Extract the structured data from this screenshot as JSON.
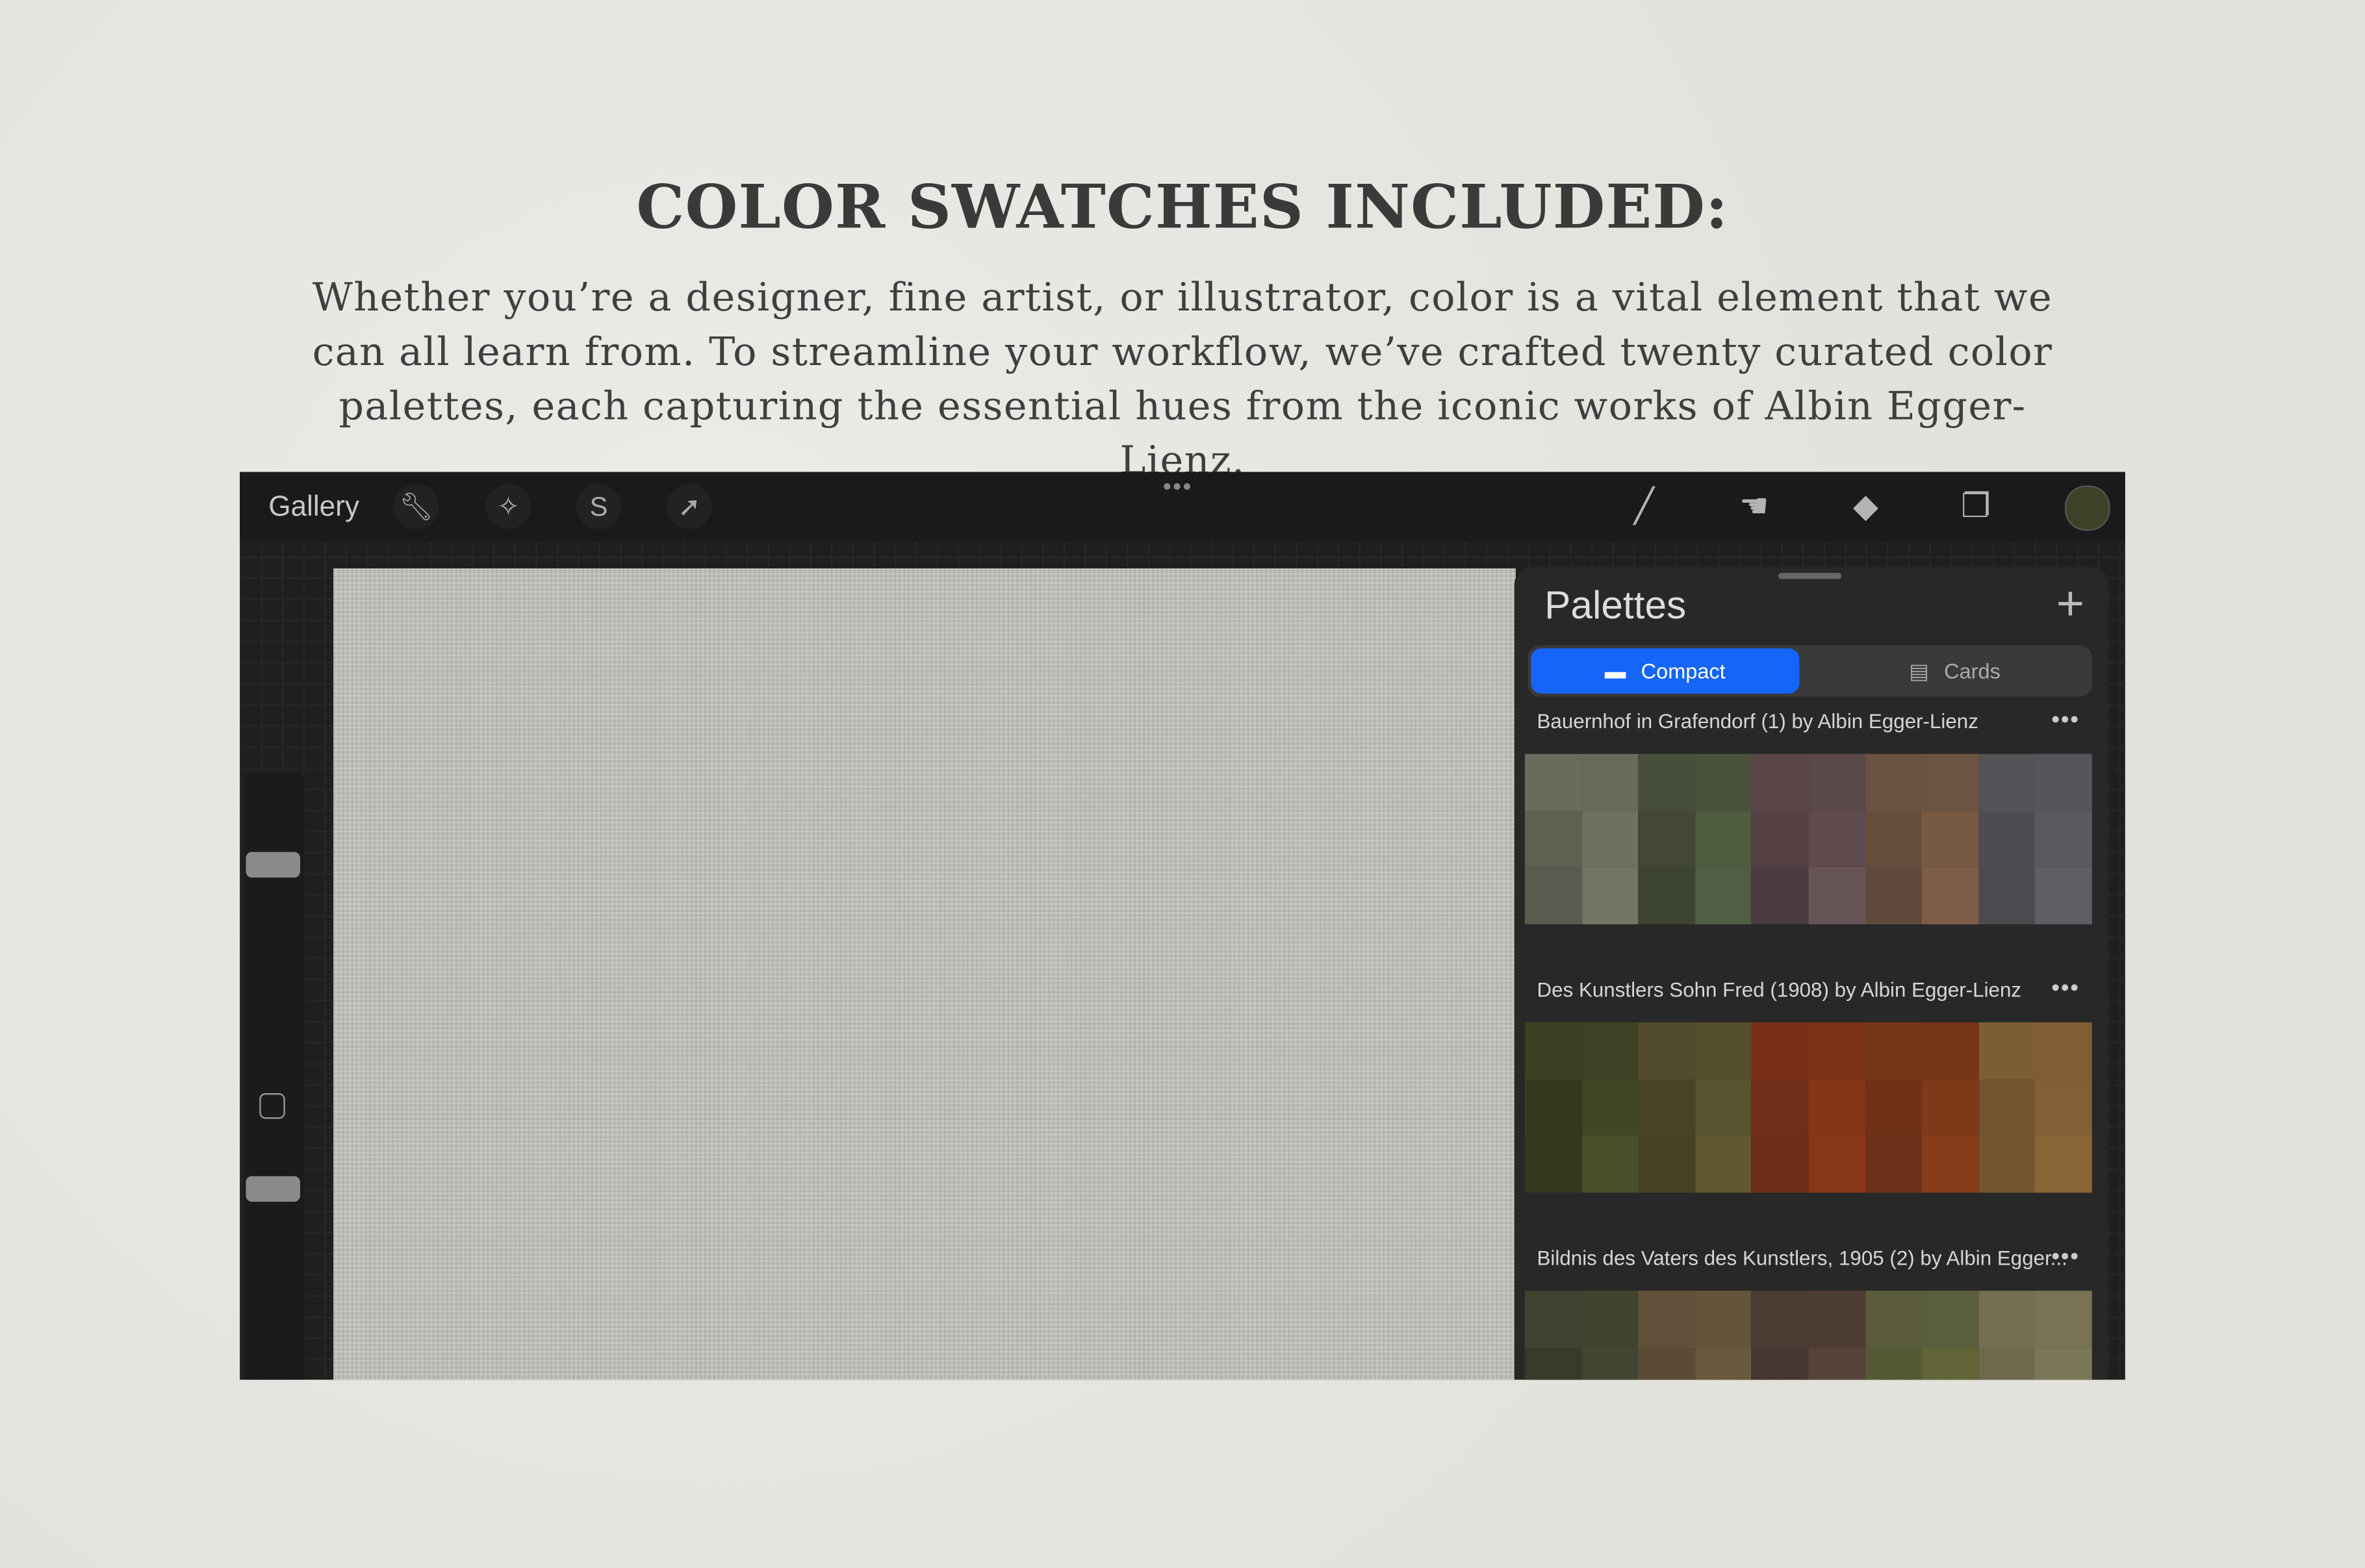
{
  "heading": "COLOR SWATCHES INCLUDED:",
  "description": "Whether you’re a designer, fine artist, or illustrator, color is a vital element that we can all learn from. To streamline your workflow, we’ve crafted twenty curated color palettes, each capturing the essential hues from the iconic works of Albin Egger-Lienz.",
  "toolbar": {
    "gallery": "Gallery",
    "left_icons": [
      "wrench-icon",
      "magic-wand-icon",
      "selection-icon",
      "transform-arrow-icon"
    ],
    "more": "•••",
    "right_icons": [
      "brush-icon",
      "smudge-icon",
      "eraser-icon",
      "layers-icon"
    ],
    "current_color": "#3e4028"
  },
  "panel": {
    "title": "Palettes",
    "add": "+",
    "tabs": [
      {
        "label": "Compact",
        "active": true
      },
      {
        "label": "Cards",
        "active": false
      }
    ],
    "palettes": [
      {
        "name": "Bauernhof in Grafendorf (1) by Albin Egger-Lienz",
        "more": "•••",
        "colors": [
          "#6b6b5d",
          "#6a6a5c",
          "#474f3a",
          "#4a523c",
          "#5a4648",
          "#5c494a",
          "#6b5341",
          "#6c5442",
          "#545358",
          "#56555b",
          "#606052",
          "#6f705f",
          "#434835",
          "#505c40",
          "#544043",
          "#5f4b4e",
          "#674d3e",
          "#785a43",
          "#4e4c52",
          "#5b5a60",
          "#5a5a4e",
          "#717562",
          "#3e4432",
          "#525e44",
          "#4a3c3e",
          "#665456",
          "#604a3d",
          "#7d5d48",
          "#4b4a4e",
          "#5f5e65"
        ]
      },
      {
        "name": "Des Kunstlers Sohn Fred (1908) by Albin Egger-Lienz",
        "more": "•••",
        "colors": [
          "#3d4123",
          "#3f4224",
          "#514a2b",
          "#554e2c",
          "#7a3018",
          "#7a3118",
          "#773518",
          "#753318",
          "#7d5d33",
          "#7f5e34",
          "#363920",
          "#434626",
          "#4a4426",
          "#57532e",
          "#702d18",
          "#853418",
          "#6f3218",
          "#7e3919",
          "#74552f",
          "#825f35",
          "#35371f",
          "#4a4e29",
          "#474025",
          "#5f5830",
          "#6c2d17",
          "#873619",
          "#6b3219",
          "#873c1a",
          "#72542f",
          "#8a6537"
        ]
      },
      {
        "name": "Bildnis des Vaters des Kunstlers, 1905 (2) by Albin Egger...",
        "more": "•••",
        "colors": [
          "#40412f",
          "#41442f",
          "#61503a",
          "#64543a",
          "#4a3c33",
          "#4e3d34",
          "#5a5c3b",
          "#5b5e3b",
          "#757052",
          "#787354",
          "#383a2a",
          "#444632",
          "#5b4a36",
          "#6a5a3d",
          "#463830",
          "#56443a",
          "#555a35",
          "#626538",
          "#6f6a4e",
          "#7b7858"
        ]
      }
    ]
  }
}
